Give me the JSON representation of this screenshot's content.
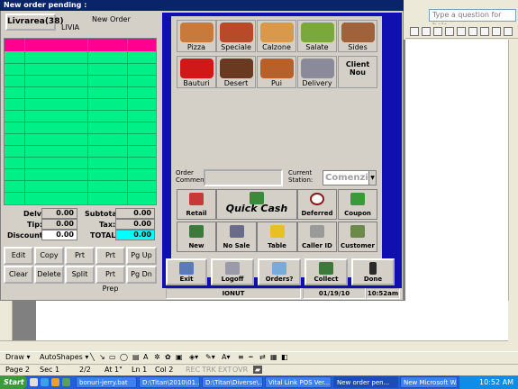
{
  "pos": {
    "title": "New order pending :",
    "livrarea_btn": "Livrarea(38)",
    "new_order_label": "New Order",
    "order_name": "LIVIA",
    "totals": {
      "delv_label": "Delv:",
      "delv": "0.00",
      "tip_label": "Tip:",
      "tip": "0.00",
      "discount_label": "Discount:",
      "discount": "0.00",
      "subtotal_label": "Subtotal:",
      "subtotal": "0.00",
      "tax_label": "Tax:",
      "tax": "0.00",
      "total_label": "TOTAL:",
      "total": "0.00"
    },
    "order_buttons": [
      "Edit",
      "Copy",
      "Prt Delv",
      "Prt Cust",
      "Pg Up",
      "Clear",
      "Delete",
      "Split",
      "Prt Prep",
      "Pg Dn"
    ],
    "categories": [
      "Pizza",
      "Speciale",
      "Calzone",
      "Salate",
      "Sides",
      "Bauturi",
      "Desert",
      "Pui",
      "Delivery",
      "Client Nou"
    ],
    "order_comment_label": "Order Comment:",
    "current_station_label": "Current Station:",
    "current_station": "Comenzi",
    "actions": [
      "Retail",
      "Quick Cash",
      "Deferred",
      "Coupon",
      "New",
      "No Sale",
      "Table",
      "Caller ID",
      "Customer"
    ],
    "bottom_buttons": [
      "Exit",
      "Logoff",
      "Orders?",
      "Collect",
      "Done"
    ],
    "status": {
      "user": "IONUT",
      "date": "01/19/10",
      "time": "10:52am"
    },
    "colors": {
      "grid": "#00f088",
      "grid_header": "#ff0090",
      "panel_border": "#1010b0",
      "title_bar": "#0a246a"
    }
  },
  "word": {
    "help_placeholder": "Type a question for help",
    "draw_label": "Draw ▾",
    "autoshapes_label": "AutoShapes ▾",
    "status": [
      "Page 2",
      "Sec 1",
      "2/2",
      "At 1\"",
      "Ln 1",
      "Col 2"
    ],
    "status_modes": [
      "REC",
      "TRK",
      "EXT",
      "OVR"
    ]
  },
  "taskbar": {
    "start": "Start",
    "tasks": [
      "bonuri-jerry.bat",
      "D:\\Titan\\2010\\01...",
      "D:\\Titan\\Diverse\\...",
      "Vital Link POS Ver...",
      "New order pen...",
      "New Microsoft W..."
    ],
    "clock": "10:52 AM"
  }
}
